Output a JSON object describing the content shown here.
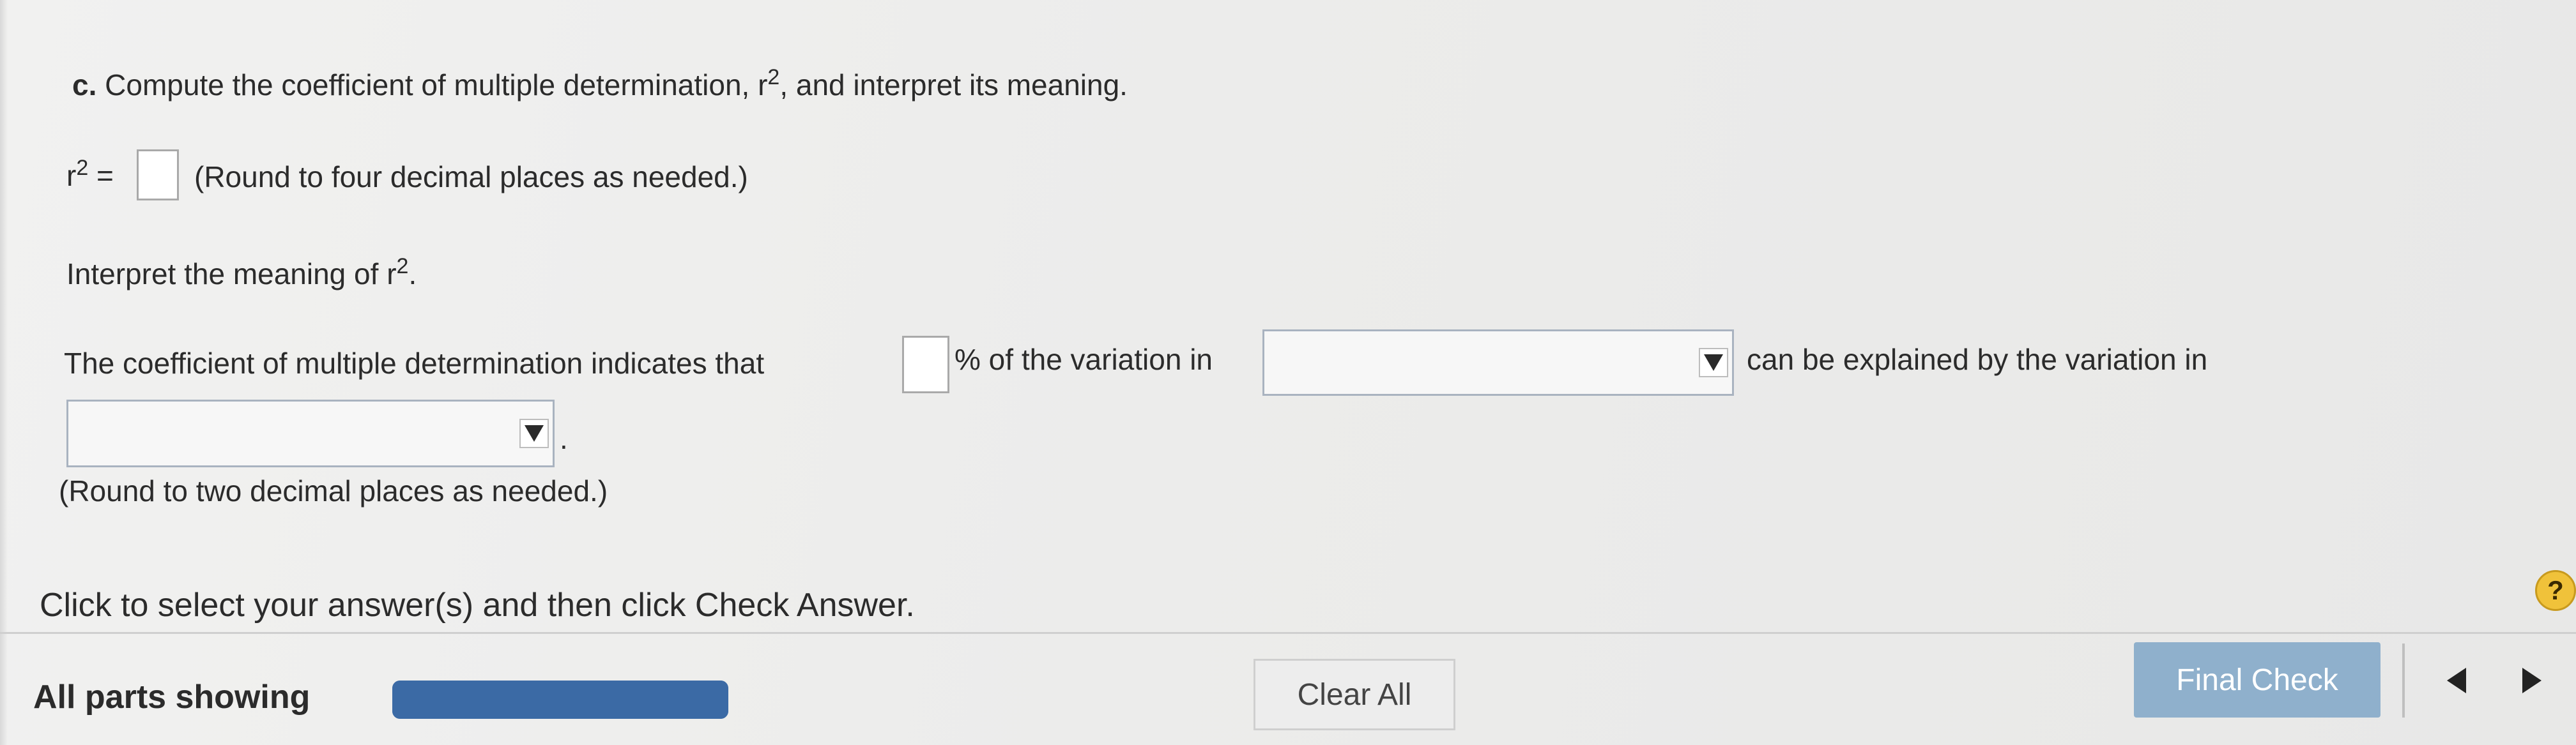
{
  "question": {
    "part_label": "c.",
    "prompt_before_sup": "Compute the coefficient of multiple determination, r",
    "prompt_sup": "2",
    "prompt_after_sup": ", and interpret its meaning.",
    "r2_label": "r",
    "r2_sup": "2",
    "r2_equals": "=",
    "r2_hint": "(Round to four decimal places as needed.)",
    "interpret_before_sup": "Interpret the meaning of r",
    "interpret_sup": "2",
    "interpret_after_sup": ".",
    "sentence_part1": "The coefficient of multiple determination indicates that",
    "sentence_part2": "% of the variation in",
    "sentence_part3": "can be explained by the variation in",
    "sentence_end": ".",
    "round_hint": "(Round to two decimal places as needed.)"
  },
  "footer": {
    "instruction": "Click to select your answer(s) and then click Check Answer.",
    "parts_label": "All parts showing",
    "progress": 1.0,
    "clear_all_label": "Clear All",
    "final_check_label": "Final Check",
    "help_label": "?"
  },
  "colors": {
    "progress": "#3f6ea8",
    "final_check": "#8fb0cc",
    "help": "#f0c23a"
  },
  "icons": {
    "dropdown": "triangle-down",
    "prev": "triangle-left",
    "next": "triangle-right",
    "help": "question-mark"
  }
}
